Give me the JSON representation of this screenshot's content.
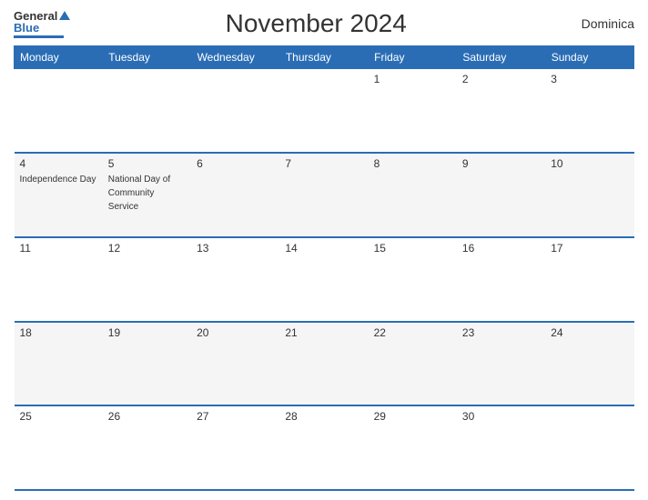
{
  "header": {
    "title": "November 2024",
    "country": "Dominica"
  },
  "logo": {
    "general": "General",
    "blue": "Blue"
  },
  "days_of_week": [
    "Monday",
    "Tuesday",
    "Wednesday",
    "Thursday",
    "Friday",
    "Saturday",
    "Sunday"
  ],
  "weeks": [
    [
      {
        "day": "",
        "event": ""
      },
      {
        "day": "",
        "event": ""
      },
      {
        "day": "",
        "event": ""
      },
      {
        "day": "",
        "event": ""
      },
      {
        "day": "1",
        "event": ""
      },
      {
        "day": "2",
        "event": ""
      },
      {
        "day": "3",
        "event": ""
      }
    ],
    [
      {
        "day": "4",
        "event": "Independence Day"
      },
      {
        "day": "5",
        "event": "National Day of Community Service"
      },
      {
        "day": "6",
        "event": ""
      },
      {
        "day": "7",
        "event": ""
      },
      {
        "day": "8",
        "event": ""
      },
      {
        "day": "9",
        "event": ""
      },
      {
        "day": "10",
        "event": ""
      }
    ],
    [
      {
        "day": "11",
        "event": ""
      },
      {
        "day": "12",
        "event": ""
      },
      {
        "day": "13",
        "event": ""
      },
      {
        "day": "14",
        "event": ""
      },
      {
        "day": "15",
        "event": ""
      },
      {
        "day": "16",
        "event": ""
      },
      {
        "day": "17",
        "event": ""
      }
    ],
    [
      {
        "day": "18",
        "event": ""
      },
      {
        "day": "19",
        "event": ""
      },
      {
        "day": "20",
        "event": ""
      },
      {
        "day": "21",
        "event": ""
      },
      {
        "day": "22",
        "event": ""
      },
      {
        "day": "23",
        "event": ""
      },
      {
        "day": "24",
        "event": ""
      }
    ],
    [
      {
        "day": "25",
        "event": ""
      },
      {
        "day": "26",
        "event": ""
      },
      {
        "day": "27",
        "event": ""
      },
      {
        "day": "28",
        "event": ""
      },
      {
        "day": "29",
        "event": ""
      },
      {
        "day": "30",
        "event": ""
      },
      {
        "day": "",
        "event": ""
      }
    ]
  ]
}
